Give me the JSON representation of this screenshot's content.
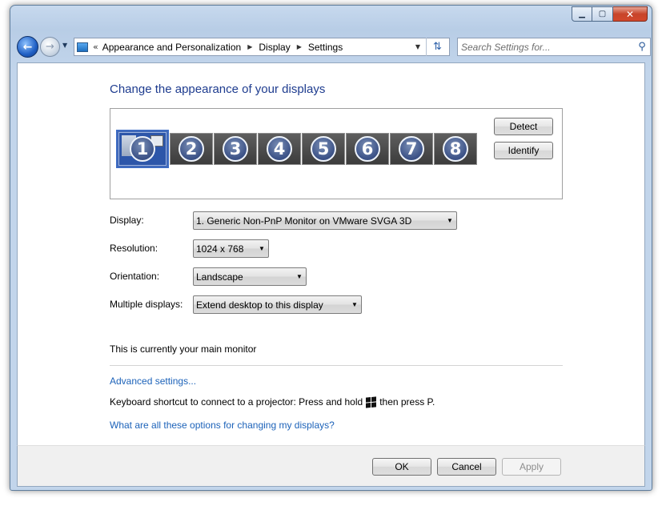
{
  "window": {
    "controls": {
      "minimize": "▁",
      "maximize": "▢",
      "close": "✕"
    }
  },
  "navigation": {
    "back_icon": "arrow-left-icon",
    "forward_icon": "arrow-right-icon",
    "breadcrumb_overflow": "«",
    "breadcrumb": [
      "Appearance and Personalization",
      "Display",
      "Settings"
    ],
    "search_placeholder": "Search Settings for..."
  },
  "main": {
    "title": "Change the appearance of your displays",
    "monitors": [
      "1",
      "2",
      "3",
      "4",
      "5",
      "6",
      "7",
      "8"
    ],
    "selected_monitor": "1",
    "detect_label": "Detect",
    "identify_label": "Identify",
    "fields": {
      "display_label": "Display:",
      "display_value": "1. Generic Non-PnP Monitor on VMware SVGA 3D",
      "resolution_label": "Resolution:",
      "resolution_value": "1024 x 768",
      "orientation_label": "Orientation:",
      "orientation_value": "Landscape",
      "multiple_label": "Multiple displays:",
      "multiple_value": "Extend desktop to this display"
    },
    "status_text": "This is currently your main monitor",
    "advanced_link": "Advanced settings...",
    "shortcut_before": "Keyboard shortcut to connect to a projector: Press and hold",
    "shortcut_after": "then press P.",
    "help_link": "What are all these options for changing my displays?"
  },
  "footer": {
    "ok_label": "OK",
    "cancel_label": "Cancel",
    "apply_label": "Apply"
  },
  "colors": {
    "title_blue": "#1e3c8f",
    "link_blue": "#1c62b9",
    "chrome_blue": "#c2d5eb"
  }
}
